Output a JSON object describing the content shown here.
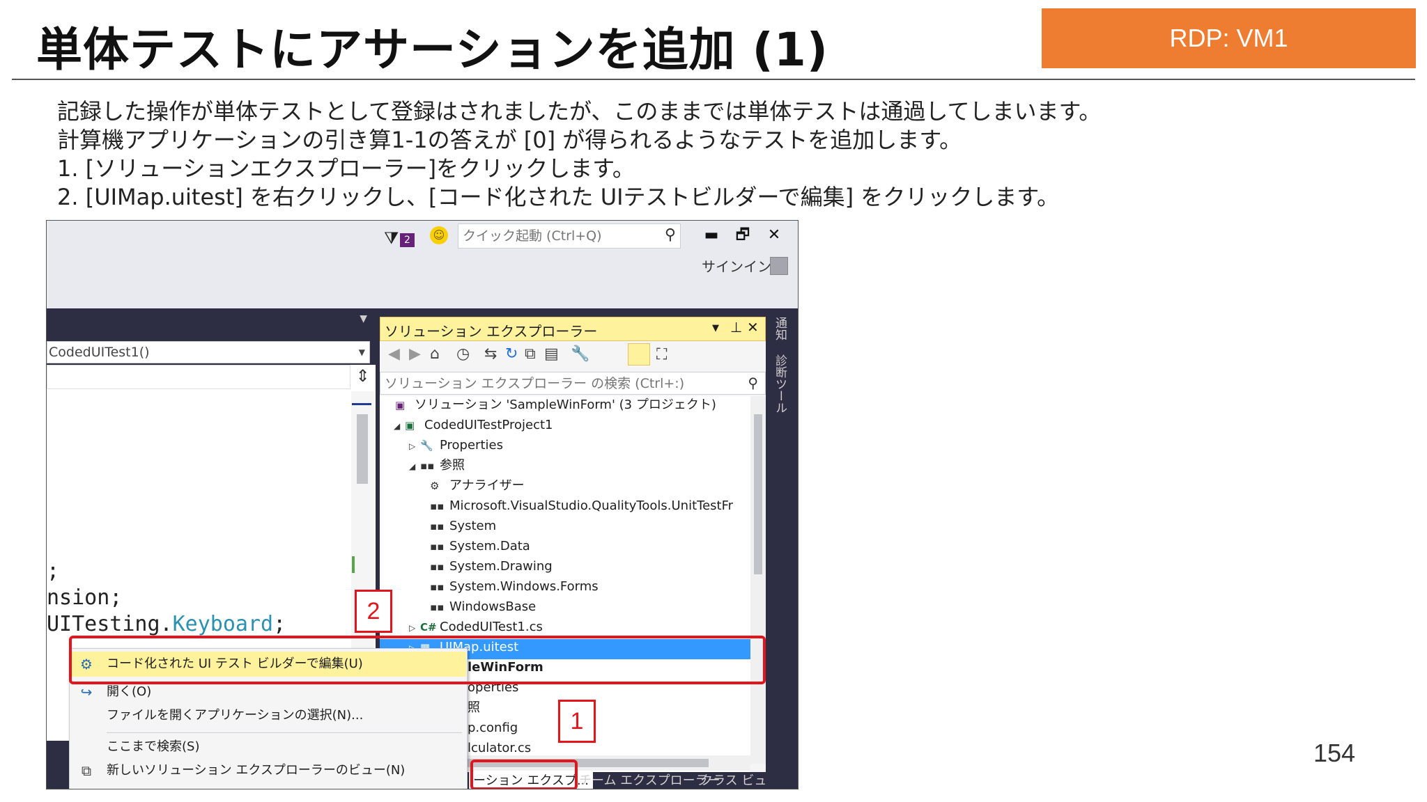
{
  "slide": {
    "title": "単体テストにアサーションを追加 (1)",
    "badge": "RDP: VM1",
    "lines": [
      "記録した操作が単体テストとして登録はされましたが、このままでは単体テストは通過してしまいます。",
      "計算機アプリケーションの引き算1-1の答えが [0] が得られるようなテストを追加します。",
      "1.  [ソリューションエクスプローラー]をクリックします。",
      "2.  [UIMap.uitest] を右クリックし、[コード化された UIテストビルダーで編集] をクリックします。"
    ],
    "page_number": "154"
  },
  "screenshot": {
    "notification_count": "2",
    "quick_launch_placeholder": "クイック起動 (Ctrl+Q)",
    "signin": "サインイン",
    "window_buttons": {
      "minimize": "▬",
      "restore": "🗗",
      "close": "✕"
    },
    "editor": {
      "combo_value": "CodedUITest1()",
      "code_lines": [
        ";",
        "nsion;",
        "UITesting."
      ],
      "code_keyword": "Keyboard",
      "code_tail": ";"
    },
    "solution_explorer": {
      "title": "ソリューション エクスプローラー",
      "search_placeholder": "ソリューション エクスプローラー の検索 (Ctrl+:)",
      "tree": [
        {
          "label": "ソリューション 'SampleWinForm' (3 プロジェクト)",
          "icon": "solution-icon",
          "expander": ""
        },
        {
          "label": "CodedUITestProject1",
          "icon": "project-icon",
          "expander": "◢"
        },
        {
          "label": "Properties",
          "icon": "wrench-icon",
          "expander": "▷"
        },
        {
          "label": "参照",
          "icon": "reference-icon",
          "expander": "◢"
        },
        {
          "label": "アナライザー",
          "icon": "analyzer-icon",
          "expander": ""
        },
        {
          "label": "Microsoft.VisualStudio.QualityTools.UnitTestFr",
          "icon": "reference-icon",
          "expander": ""
        },
        {
          "label": "System",
          "icon": "reference-icon",
          "expander": ""
        },
        {
          "label": "System.Data",
          "icon": "reference-icon",
          "expander": ""
        },
        {
          "label": "System.Drawing",
          "icon": "reference-icon",
          "expander": ""
        },
        {
          "label": "System.Windows.Forms",
          "icon": "reference-icon",
          "expander": ""
        },
        {
          "label": "WindowsBase",
          "icon": "reference-icon",
          "expander": ""
        },
        {
          "label": "CodedUITest1.cs",
          "icon": "csharp-icon",
          "expander": "▷"
        },
        {
          "label": "UIMap.uitest",
          "icon": "uitest-icon",
          "expander": "▷"
        },
        {
          "label": "leWinForm",
          "icon": "",
          "expander": ""
        },
        {
          "label": "operties",
          "icon": "",
          "expander": ""
        },
        {
          "label": "照",
          "icon": "",
          "expander": ""
        },
        {
          "label": "p.config",
          "icon": "",
          "expander": ""
        },
        {
          "label": "lculator.cs",
          "icon": "",
          "expander": ""
        }
      ],
      "tabs": [
        "ーション エクスプ...",
        "チーム エクスプローラー",
        "クラス ビュー"
      ]
    },
    "side_tabs": [
      "通知",
      "診断ツール"
    ],
    "context_menu": [
      {
        "label": "コード化された UI テスト ビルダーで編集(U)",
        "icon": "uitest-builder-icon"
      },
      {
        "label": "開く(O)",
        "icon": "open-icon"
      },
      {
        "label": "ファイルを開くアプリケーションの選択(N)...",
        "icon": ""
      },
      {
        "label": "ここまで検索(S)",
        "icon": ""
      },
      {
        "label": "新しいソリューション エクスプローラーのビュー(N)",
        "icon": "new-view-icon"
      }
    ],
    "annotations": {
      "step1": "1",
      "step2": "2"
    },
    "accent_color": "#ee7c31",
    "annotation_color": "#e3141b"
  }
}
